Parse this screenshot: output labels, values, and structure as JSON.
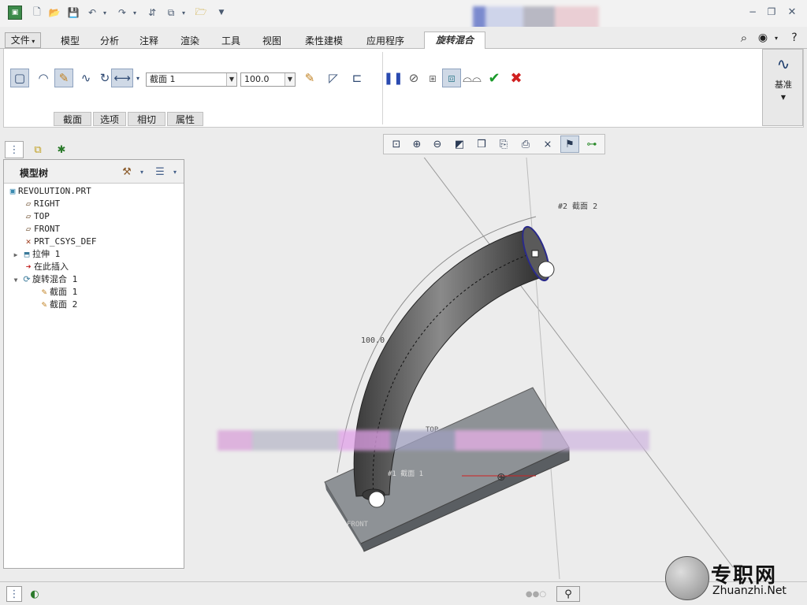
{
  "menu": {
    "file_label": "文件",
    "tabs": [
      "模型",
      "分析",
      "注释",
      "渲染",
      "工具",
      "视图",
      "柔性建模",
      "应用程序"
    ],
    "active_tab": "旋转混合"
  },
  "ribbon": {
    "section_combo": "截面 1",
    "angle_combo": "100.0",
    "datum_label": "基准",
    "subtabs": [
      "截面",
      "选项",
      "相切",
      "属性"
    ]
  },
  "model_tree": {
    "header": "模型树",
    "items": [
      {
        "label": "REVOLUTION.PRT",
        "icon": "part-icon",
        "indent": 0
      },
      {
        "label": "RIGHT",
        "icon": "datum-plane-icon",
        "indent": 1
      },
      {
        "label": "TOP",
        "icon": "datum-plane-icon",
        "indent": 1
      },
      {
        "label": "FRONT",
        "icon": "datum-plane-icon",
        "indent": 1
      },
      {
        "label": "PRT_CSYS_DEF",
        "icon": "csys-icon",
        "indent": 1
      },
      {
        "label": "拉伸 1",
        "icon": "extrude-icon",
        "indent": 1
      },
      {
        "label": "在此插入",
        "icon": "insert-arrow-icon",
        "indent": 1
      },
      {
        "label": "旋转混合 1",
        "icon": "revolve-blend-icon",
        "indent": 1
      },
      {
        "label": "截面 1",
        "icon": "sketch-icon",
        "indent": 2
      },
      {
        "label": "截面 2",
        "icon": "sketch-icon",
        "indent": 2
      }
    ]
  },
  "viewport": {
    "dim_angle": "100.0",
    "section_label_2": "#2 截面 2",
    "section_label_1": "#1 截面 1",
    "top_label": "TOP",
    "front_label": "FRONT"
  },
  "watermark": {
    "brand": "专职网",
    "url": "Zhuanzhi.Net"
  },
  "colors": {
    "accent_green": "#1a9a2a",
    "cancel_red": "#d02020",
    "section_outline": "#2a2a8a"
  }
}
